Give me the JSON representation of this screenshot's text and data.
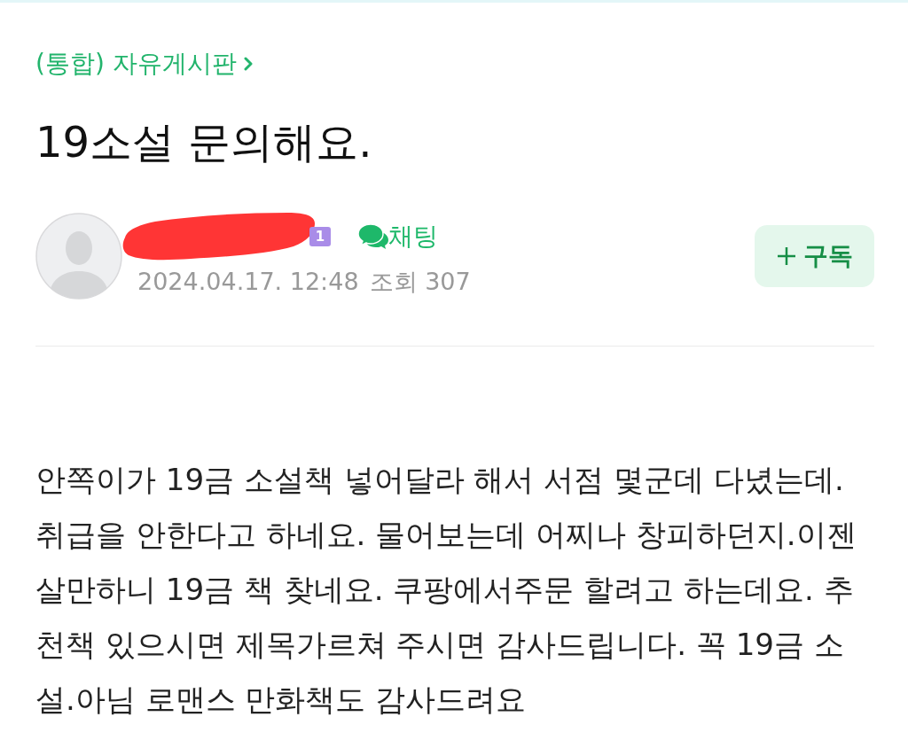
{
  "breadcrumb": {
    "label": "(통합) 자유게시판"
  },
  "post": {
    "title": "19소설 문의해요."
  },
  "author": {
    "redacted": true,
    "level": "1",
    "chat_label": "채팅",
    "date": "2024.04.17. 12:48",
    "views": "조회 307"
  },
  "subscribe_button": {
    "label": "구독"
  },
  "body": {
    "text": "안쪽이가 19금 소설책 넣어달라 해서 서점 몇군데 다녔는데. 취급을 안한다고 하네요. 물어보는데 어찌나 창피하던지.이젠 살만하니 19금 책 찾네요. 쿠팡에서주문 할려고 하는데요. 추천책 있으시면 제목가르쳐 주시면 감사드립니다. 꼭 19금 소설.아님 로맨스 만화책도 감사드려요"
  }
}
